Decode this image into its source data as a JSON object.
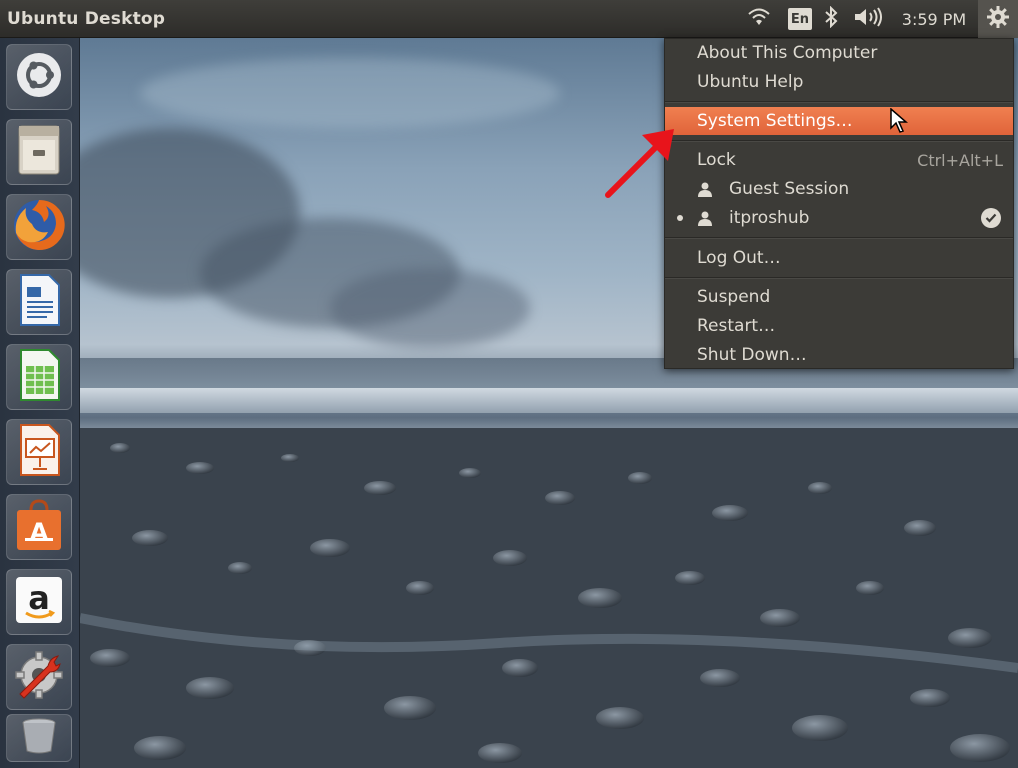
{
  "panel": {
    "title": "Ubuntu Desktop",
    "language": "En",
    "clock": "3:59 PM"
  },
  "launcher": {
    "items": [
      {
        "name": "dash-home",
        "icon": "ubuntu-logo-icon"
      },
      {
        "name": "files",
        "icon": "file-cabinet-icon"
      },
      {
        "name": "firefox",
        "icon": "firefox-icon"
      },
      {
        "name": "libreoffice-writer",
        "icon": "writer-document-icon"
      },
      {
        "name": "libreoffice-calc",
        "icon": "calc-spreadsheet-icon"
      },
      {
        "name": "libreoffice-impress",
        "icon": "impress-presentation-icon"
      },
      {
        "name": "ubuntu-software-center",
        "icon": "software-bag-icon"
      },
      {
        "name": "amazon",
        "icon": "amazon-icon"
      },
      {
        "name": "system-settings",
        "icon": "wrench-gear-icon"
      },
      {
        "name": "trash",
        "icon": "trash-icon"
      }
    ]
  },
  "session_menu": {
    "about": "About This Computer",
    "help": "Ubuntu Help",
    "system_settings": "System Settings…",
    "lock": "Lock",
    "lock_shortcut": "Ctrl+Alt+L",
    "guest": "Guest Session",
    "user": "itproshub",
    "logout": "Log Out…",
    "suspend": "Suspend",
    "restart": "Restart…",
    "shutdown": "Shut Down…"
  },
  "colors": {
    "panel_bg": "#3c3b37",
    "highlight": "#e9683e",
    "annotation_arrow": "#e8141b"
  }
}
